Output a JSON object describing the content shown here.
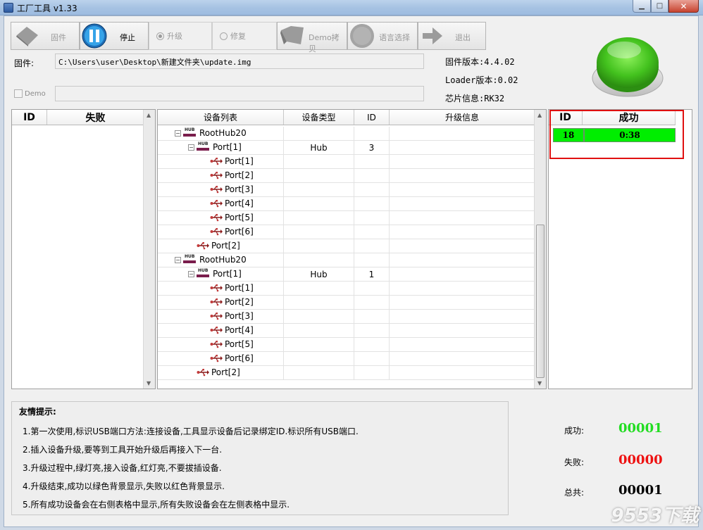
{
  "window": {
    "title": "工厂工具 v1.33"
  },
  "toolbar": {
    "firmware_label": "固件",
    "stop_label": "停止",
    "upgrade_label": "升级",
    "repair_label": "修复",
    "demo_copy_label": "Demo拷贝",
    "language_label": "语言选择",
    "exit_label": "退出"
  },
  "firmware": {
    "label": "固件:",
    "path": "C:\\Users\\user\\Desktop\\新建文件夹\\update.img",
    "demo_label": "Demo"
  },
  "info": {
    "firmware_version": "固件版本:4.4.02",
    "loader_version": "Loader版本:0.02",
    "chip_info": "芯片信息:RK32"
  },
  "fail_table": {
    "id_header": "ID",
    "status_header": "失败"
  },
  "device_table": {
    "headers": [
      "设备列表",
      "设备类型",
      "ID",
      "升级信息"
    ],
    "rows": [
      {
        "label": "RootHub20",
        "type": "",
        "id": ""
      },
      {
        "label": "Port[1]",
        "type": "Hub",
        "id": "3"
      },
      {
        "label": "Port[1]",
        "type": "",
        "id": ""
      },
      {
        "label": "Port[2]",
        "type": "",
        "id": ""
      },
      {
        "label": "Port[3]",
        "type": "",
        "id": ""
      },
      {
        "label": "Port[4]",
        "type": "",
        "id": ""
      },
      {
        "label": "Port[5]",
        "type": "",
        "id": ""
      },
      {
        "label": "Port[6]",
        "type": "",
        "id": ""
      },
      {
        "label": "Port[2]",
        "type": "",
        "id": ""
      },
      {
        "label": "RootHub20",
        "type": "",
        "id": ""
      },
      {
        "label": "Port[1]",
        "type": "Hub",
        "id": "1"
      },
      {
        "label": "Port[1]",
        "type": "",
        "id": ""
      },
      {
        "label": "Port[2]",
        "type": "",
        "id": ""
      },
      {
        "label": "Port[3]",
        "type": "",
        "id": ""
      },
      {
        "label": "Port[4]",
        "type": "",
        "id": ""
      },
      {
        "label": "Port[5]",
        "type": "",
        "id": ""
      },
      {
        "label": "Port[6]",
        "type": "",
        "id": ""
      },
      {
        "label": "Port[2]",
        "type": "",
        "id": ""
      }
    ]
  },
  "success_table": {
    "id_header": "ID",
    "status_header": "成功",
    "rows": [
      {
        "id": "18",
        "time": "0:38"
      }
    ]
  },
  "tips": {
    "title": "友情提示:",
    "items": [
      "1.第一次使用,标识USB端口方法:连接设备,工具显示设备后记录绑定ID.标识所有USB端口.",
      "2.插入设备升级,要等到工具开始升级后再接入下一台.",
      "3.升级过程中,绿灯亮,接入设备,红灯亮,不要拔插设备.",
      "4.升级结束,成功以绿色背景显示,失败以红色背景显示.",
      "5.所有成功设备会在右侧表格中显示,所有失败设备会在左侧表格中显示."
    ]
  },
  "stats": {
    "success_label": "成功:",
    "success_value": "00001",
    "fail_label": "失败:",
    "fail_value": "00000",
    "total_label": "总共:",
    "total_value": "00001",
    "success_color": "#22dd22",
    "fail_color": "#ee1111"
  },
  "watermark": "9553下载"
}
